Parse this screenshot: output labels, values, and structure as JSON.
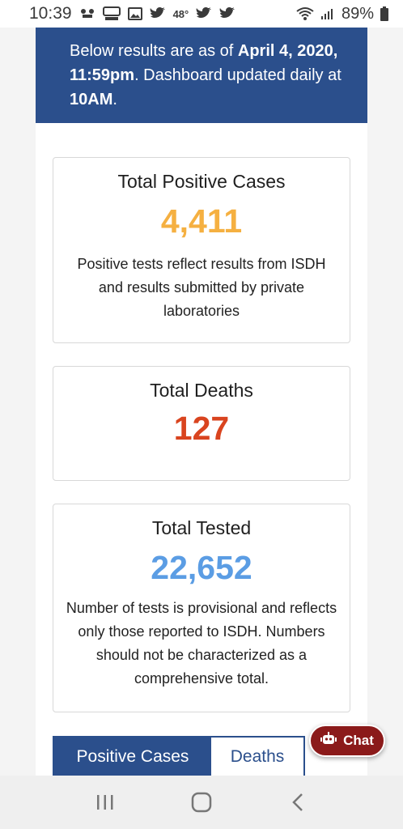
{
  "status_bar": {
    "time": "10:39",
    "temperature": "48°",
    "battery": "89%",
    "icons": [
      "voicemail-icon",
      "news-app-icon",
      "image-icon",
      "twitter-icon",
      "twitter-icon",
      "twitter-icon",
      "wifi-icon",
      "signal-icon",
      "battery-icon"
    ]
  },
  "banner": {
    "text_before": "Below results are as of ",
    "date": "April 4, 2020, 11:59pm",
    "text_middle": ". Dashboard updated daily at ",
    "time": "10AM",
    "text_end": "."
  },
  "cards": {
    "positive": {
      "title": "Total Positive Cases",
      "value": "4,411",
      "note": "Positive tests reflect results from ISDH and results submitted by private laboratories"
    },
    "deaths": {
      "title": "Total Deaths",
      "value": "127"
    },
    "tested": {
      "title": "Total Tested",
      "value": "22,652",
      "note": "Number of tests is provisional and reflects only those reported to ISDH. Numbers should not be characterized as a comprehensive total."
    }
  },
  "tabs": {
    "positive_label": "Positive Cases",
    "deaths_label": "Deaths",
    "active": "Positive Cases"
  },
  "chat": {
    "label": "Chat"
  },
  "colors": {
    "banner_blue": "#2b4f8c",
    "positive_value": "#f5b041",
    "deaths_value": "#d9441f",
    "tested_value": "#5b9de4",
    "chat_red": "#8b1a1a"
  }
}
